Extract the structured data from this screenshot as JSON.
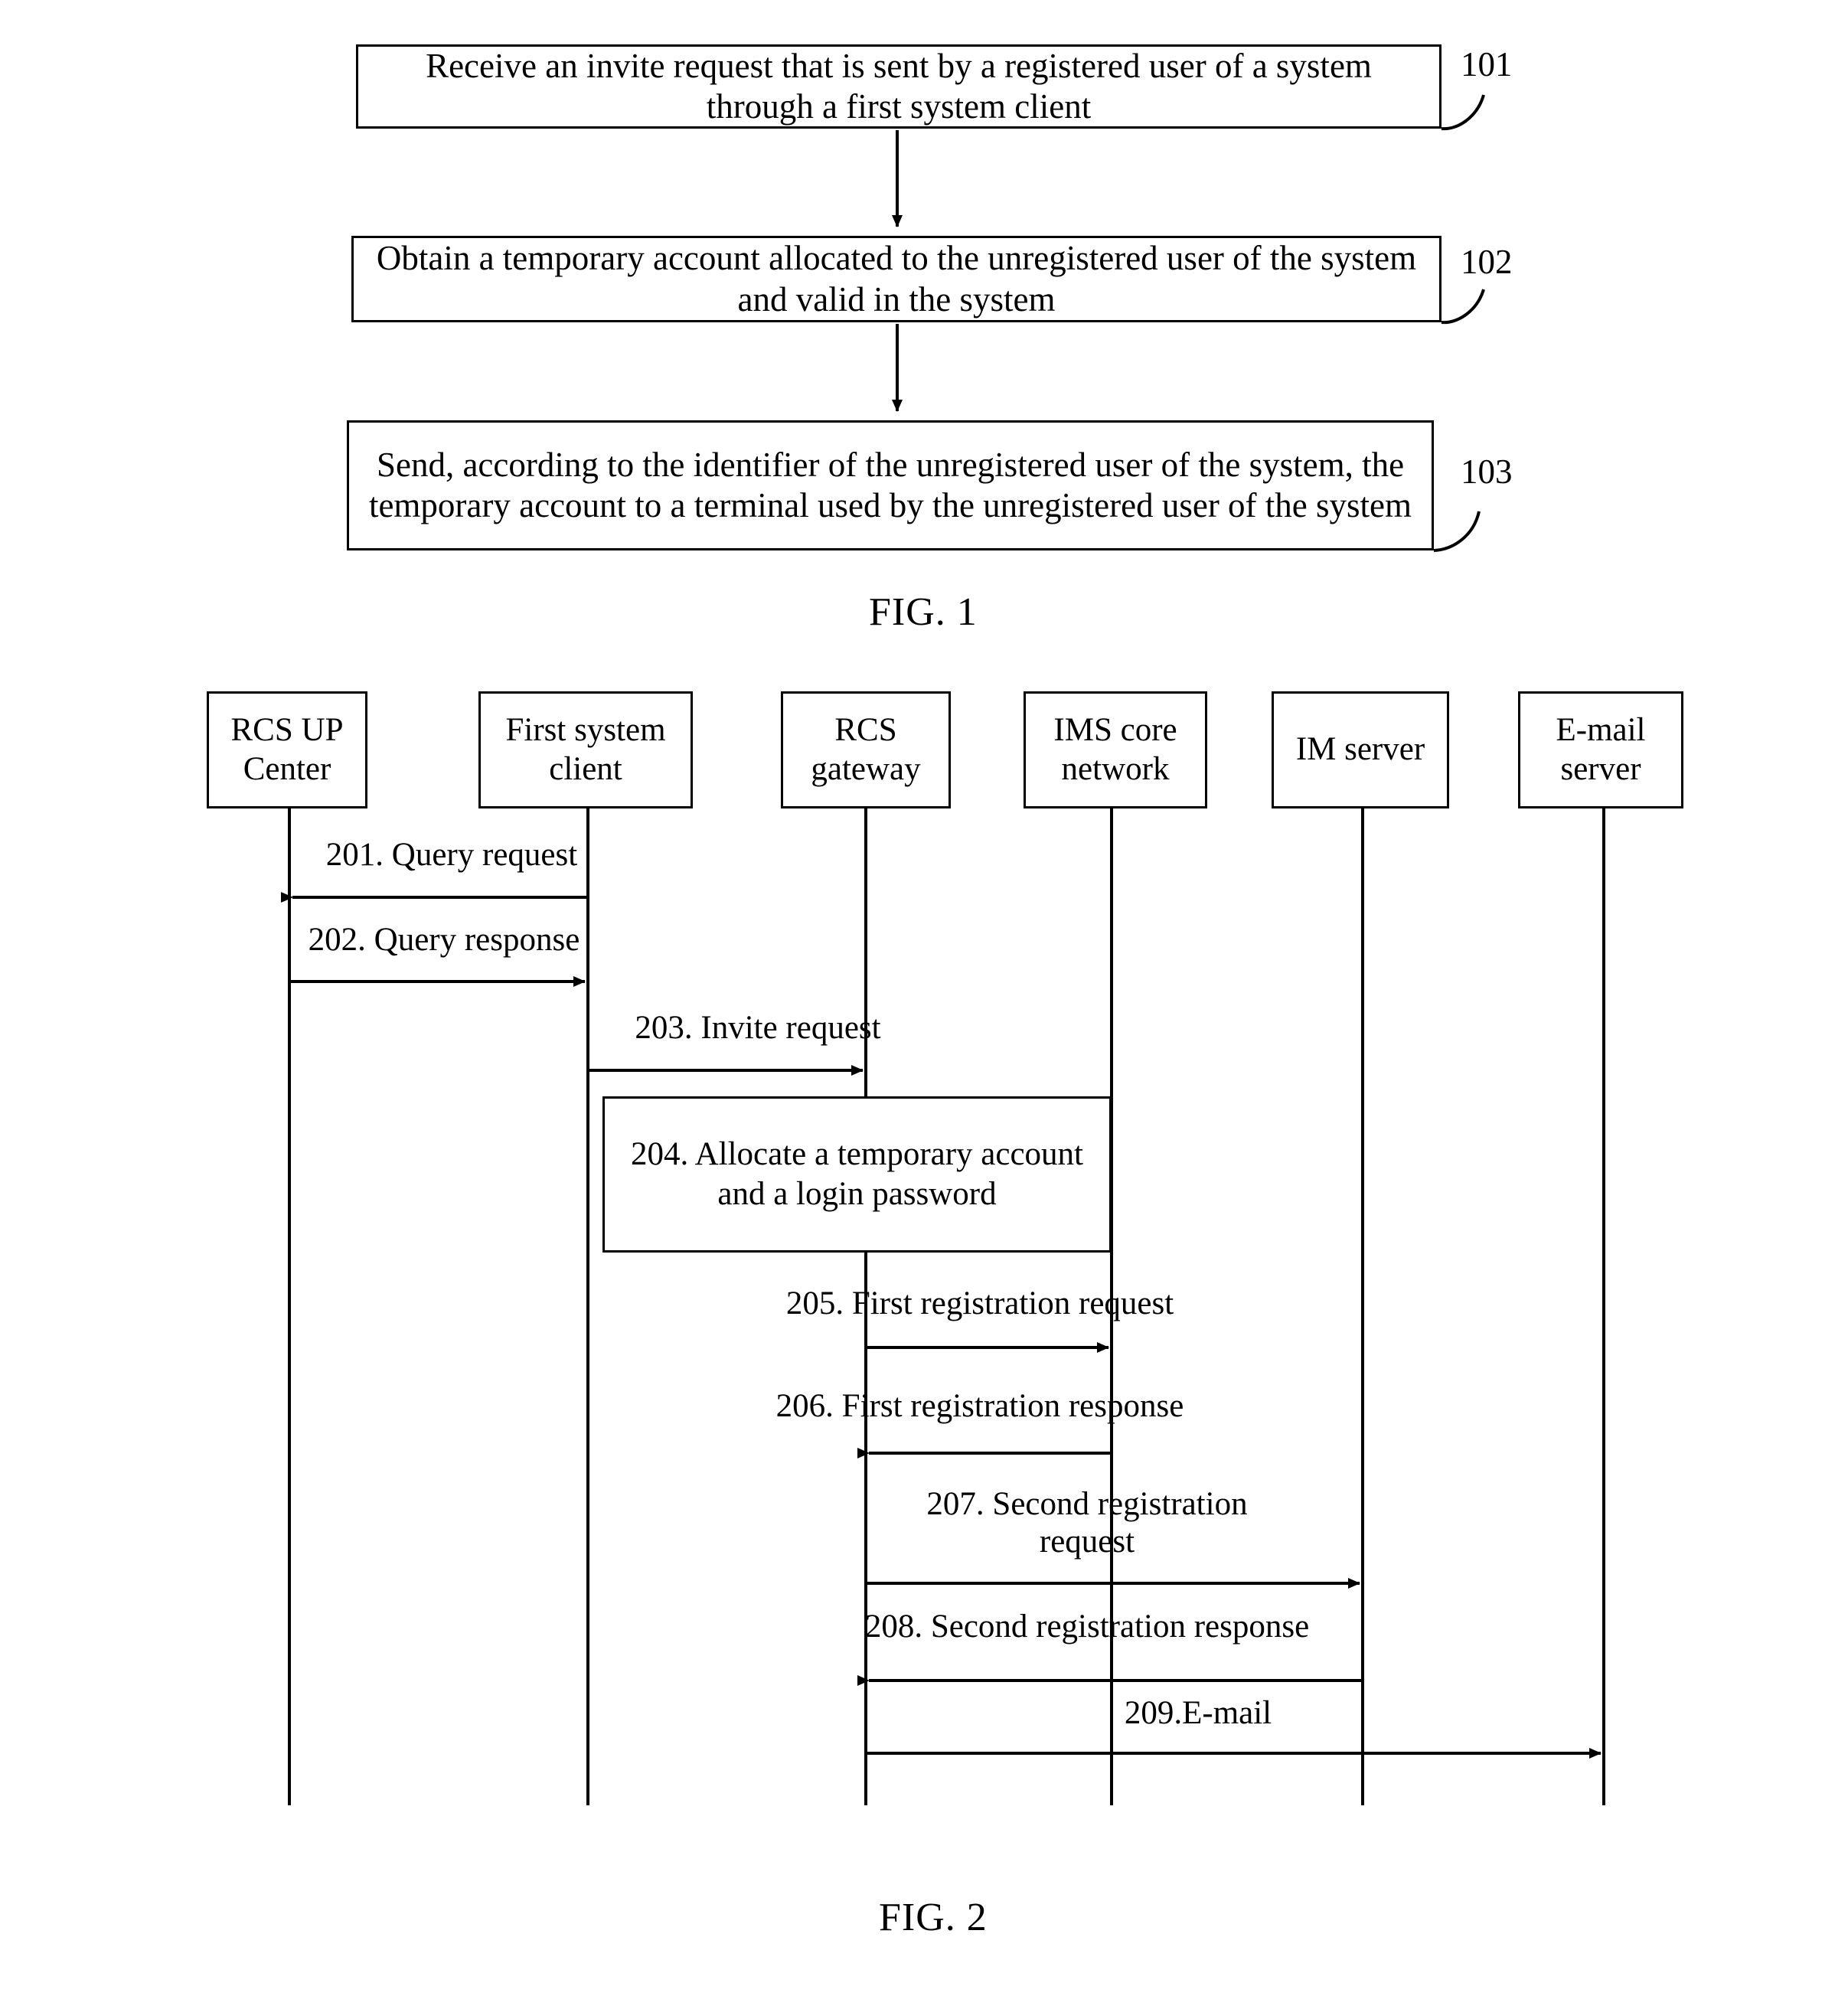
{
  "figure1": {
    "caption": "FIG. 1",
    "steps": [
      {
        "ref": "101",
        "text": "Receive an invite request that is sent by a registered user of a system through a first system client"
      },
      {
        "ref": "102",
        "text": "Obtain a temporary account allocated to the unregistered user of the system and valid in the system"
      },
      {
        "ref": "103",
        "text": "Send, according to the identifier of the unregistered user of the system, the temporary account to a terminal used by the unregistered user of the system"
      }
    ]
  },
  "figure2": {
    "caption": "FIG. 2",
    "actors": [
      {
        "id": "rcs-up-center",
        "label": "RCS UP Center"
      },
      {
        "id": "first-system-client",
        "label": "First system client"
      },
      {
        "id": "rcs-gateway",
        "label": "RCS gateway"
      },
      {
        "id": "ims-core-network",
        "label": "IMS core network"
      },
      {
        "id": "im-server",
        "label": "IM server"
      },
      {
        "id": "email-server",
        "label": "E-mail server"
      }
    ],
    "messages": [
      {
        "id": "201",
        "label": "201. Query request"
      },
      {
        "id": "202",
        "label": "202. Query response"
      },
      {
        "id": "203",
        "label": "203. Invite request"
      },
      {
        "id": "205",
        "label": "205. First registration request"
      },
      {
        "id": "206",
        "label": "206. First registration response"
      },
      {
        "id": "207",
        "label": "207. Second registration\nrequest"
      },
      {
        "id": "208",
        "label": "208. Second registration response"
      },
      {
        "id": "209",
        "label": "209.E-mail"
      }
    ],
    "actions": [
      {
        "id": "204",
        "label": "204. Allocate a temporary account and a login password"
      }
    ]
  }
}
